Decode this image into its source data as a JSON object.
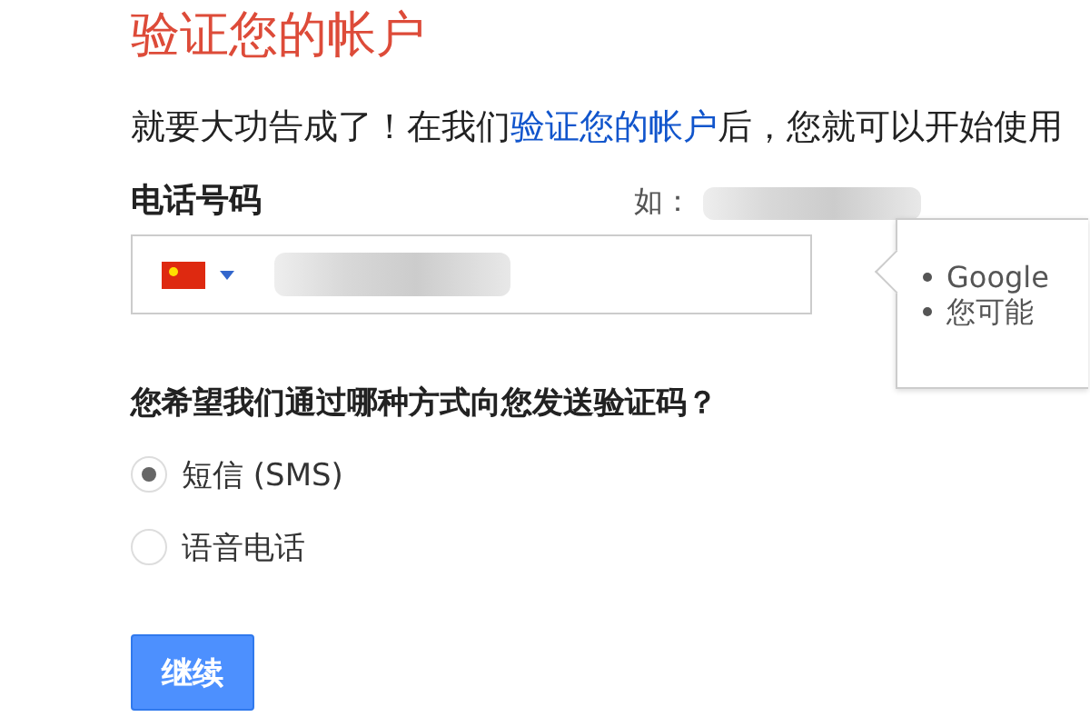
{
  "title": "验证您的帐户",
  "intro": {
    "before": "就要大功告成了！在我们",
    "link": "验证您的帐户",
    "after": "后，您就可以开始使用"
  },
  "phone": {
    "label": "电话号码",
    "example_label": "如："
  },
  "tooltip": {
    "items": [
      "Google",
      "您可能"
    ]
  },
  "question": "您希望我们通过哪种方式向您发送验证码？",
  "options": [
    {
      "label": "短信 (SMS)",
      "selected": true
    },
    {
      "label": "语音电话",
      "selected": false
    }
  ],
  "button": "继续"
}
